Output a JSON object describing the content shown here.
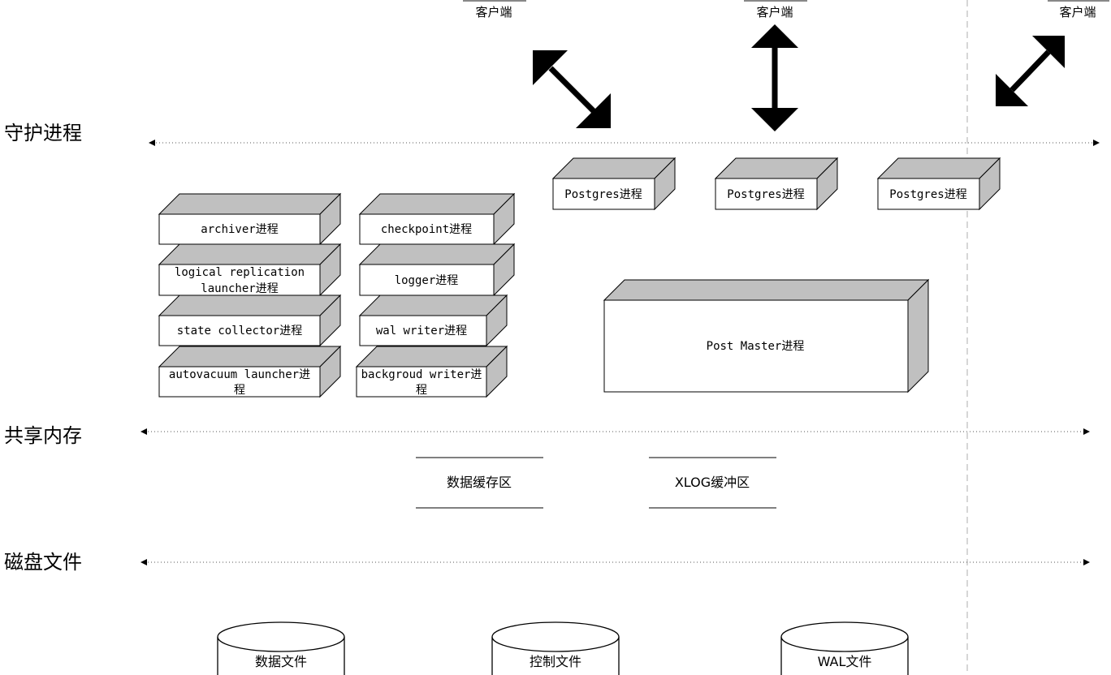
{
  "layers": {
    "daemon": "守护进程",
    "shared_memory": "共享内存",
    "disk_files": "磁盘文件"
  },
  "clients": [
    "客户端",
    "客户端",
    "客户端"
  ],
  "postgres_processes": [
    "Postgres进程",
    "Postgres进程",
    "Postgres进程"
  ],
  "postmaster": "Post Master进程",
  "background_processes": {
    "left_column": [
      [
        "archiver进程"
      ],
      [
        "logical replication",
        "launcher进程"
      ],
      [
        "state collector进程"
      ],
      [
        "autovacuum launcher进",
        "程"
      ]
    ],
    "right_column": [
      [
        "checkpoint进程"
      ],
      [
        "logger进程"
      ],
      [
        "wal writer进程"
      ],
      [
        "backgroud writer进",
        "程"
      ]
    ]
  },
  "memory_areas": [
    "数据缓存区",
    "XLOG缓冲区"
  ],
  "disk_stores": [
    "数据文件",
    "控制文件",
    "WAL文件"
  ],
  "colors": {
    "box_side": "#c0c0c0",
    "stroke": "#000000",
    "dashed_separator": "#bbbbbb"
  }
}
